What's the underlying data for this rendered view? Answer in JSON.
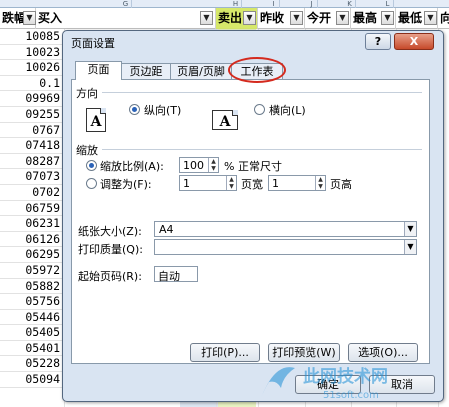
{
  "sheet": {
    "column_letters": [
      "G",
      "H",
      "I",
      "J",
      "K",
      "L"
    ],
    "headers": [
      "跌幅",
      "买入",
      "卖出",
      "昨收",
      "今开",
      "最高",
      "最低",
      "向"
    ],
    "row_values": [
      "10085",
      "10023",
      "10026",
      "0.1",
      "09969",
      "09255",
      "0767",
      "07418",
      "08287",
      "07073",
      "0702",
      "06759",
      "06231",
      "06126",
      "06295",
      "05972",
      "05882",
      "05756",
      "05446",
      "05405",
      "05401",
      "05228",
      "05094"
    ]
  },
  "dialog": {
    "title": "页面设置",
    "help_symbol": "?",
    "close_symbol": "X",
    "tabs": [
      "页面",
      "页边距",
      "页眉/页脚",
      "工作表"
    ],
    "orientation": {
      "section": "方向",
      "page_glyph": "A",
      "portrait": "纵向(T)",
      "landscape": "横向(L)"
    },
    "scaling": {
      "section": "缩放",
      "adjust_label": "缩放比例(A):",
      "adjust_value": "100",
      "adjust_suffix": "% 正常尺寸",
      "fit_label": "调整为(F):",
      "fit_wide_value": "1",
      "fit_wide_suffix": "页宽",
      "fit_tall_value": "1",
      "fit_tall_suffix": "页高"
    },
    "paper_size_label": "纸张大小(Z):",
    "paper_size_value": "A4",
    "print_quality_label": "打印质量(Q):",
    "print_quality_value": "",
    "first_page_label": "起始页码(R):",
    "first_page_value": "自动",
    "buttons": {
      "print": "打印(P)...",
      "preview": "打印预览(W)",
      "options": "选项(O)...",
      "ok": "确定",
      "cancel": "取消"
    }
  },
  "watermark": {
    "line1": "此网技术网",
    "line2": "51soft.com"
  }
}
